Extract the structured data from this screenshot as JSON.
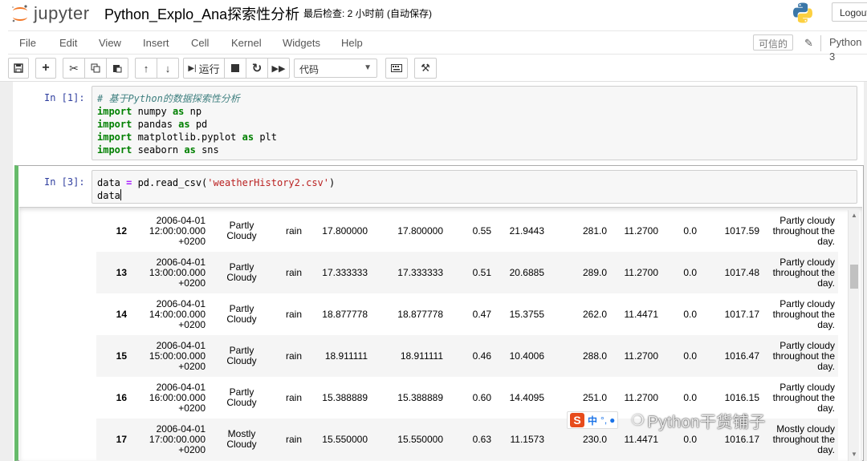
{
  "header": {
    "logo_text": "jupyter",
    "notebook_title": "Python_Explo_Ana探索性分析",
    "checkpoint": "最后检查: 2 小时前  (自动保存)",
    "logout_label": "Logout"
  },
  "menubar": {
    "items": [
      "File",
      "Edit",
      "View",
      "Insert",
      "Cell",
      "Kernel",
      "Widgets",
      "Help"
    ],
    "trusted_label": "可信的",
    "kernel_name": "Python 3"
  },
  "toolbar": {
    "run_label": "运行",
    "cell_type": "代码"
  },
  "cells": [
    {
      "prompt": "In  [1]:",
      "lines": [
        [
          {
            "t": "# 基于Python的数据探索性分析",
            "c": "c-comment"
          }
        ],
        [
          {
            "t": "import",
            "c": "c-kw"
          },
          {
            "t": " numpy ",
            "c": ""
          },
          {
            "t": "as",
            "c": "c-kw"
          },
          {
            "t": " np",
            "c": ""
          }
        ],
        [
          {
            "t": "import",
            "c": "c-kw"
          },
          {
            "t": " pandas ",
            "c": ""
          },
          {
            "t": "as",
            "c": "c-kw"
          },
          {
            "t": " pd",
            "c": ""
          }
        ],
        [
          {
            "t": "import",
            "c": "c-kw"
          },
          {
            "t": " matplotlib.pyplot ",
            "c": ""
          },
          {
            "t": "as",
            "c": "c-kw"
          },
          {
            "t": " plt",
            "c": ""
          }
        ],
        [
          {
            "t": "import",
            "c": "c-kw"
          },
          {
            "t": " seaborn ",
            "c": ""
          },
          {
            "t": "as",
            "c": "c-kw"
          },
          {
            "t": " sns",
            "c": ""
          }
        ]
      ]
    },
    {
      "prompt": "In  [3]:",
      "lines": [
        [
          {
            "t": "data ",
            "c": ""
          },
          {
            "t": "=",
            "c": "c-op"
          },
          {
            "t": " pd.read_csv(",
            "c": ""
          },
          {
            "t": "'weatherHistory2.csv'",
            "c": "c-str"
          },
          {
            "t": ")",
            "c": ""
          }
        ],
        [
          {
            "t": "data",
            "c": ""
          }
        ]
      ]
    }
  ],
  "table": {
    "rows": [
      {
        "index": "12",
        "date": [
          "2006-04-01",
          "12:00:00.000",
          "+0200"
        ],
        "summary": [
          "Partly",
          "Cloudy"
        ],
        "precip": "rain",
        "temp": "17.800000",
        "apparent": "17.800000",
        "humidity": "0.55",
        "wind_speed": "21.9443",
        "wind_bearing": "281.0",
        "visibility": "11.2700",
        "loud_cover": "0.0",
        "pressure": "1017.59",
        "daily": [
          "Partly cloudy",
          "throughout the",
          "day."
        ]
      },
      {
        "index": "13",
        "date": [
          "2006-04-01",
          "13:00:00.000",
          "+0200"
        ],
        "summary": [
          "Partly",
          "Cloudy"
        ],
        "precip": "rain",
        "temp": "17.333333",
        "apparent": "17.333333",
        "humidity": "0.51",
        "wind_speed": "20.6885",
        "wind_bearing": "289.0",
        "visibility": "11.2700",
        "loud_cover": "0.0",
        "pressure": "1017.48",
        "daily": [
          "Partly cloudy",
          "throughout the",
          "day."
        ]
      },
      {
        "index": "14",
        "date": [
          "2006-04-01",
          "14:00:00.000",
          "+0200"
        ],
        "summary": [
          "Partly",
          "Cloudy"
        ],
        "precip": "rain",
        "temp": "18.877778",
        "apparent": "18.877778",
        "humidity": "0.47",
        "wind_speed": "15.3755",
        "wind_bearing": "262.0",
        "visibility": "11.4471",
        "loud_cover": "0.0",
        "pressure": "1017.17",
        "daily": [
          "Partly cloudy",
          "throughout the",
          "day."
        ]
      },
      {
        "index": "15",
        "date": [
          "2006-04-01",
          "15:00:00.000",
          "+0200"
        ],
        "summary": [
          "Partly",
          "Cloudy"
        ],
        "precip": "rain",
        "temp": "18.911111",
        "apparent": "18.911111",
        "humidity": "0.46",
        "wind_speed": "10.4006",
        "wind_bearing": "288.0",
        "visibility": "11.2700",
        "loud_cover": "0.0",
        "pressure": "1016.47",
        "daily": [
          "Partly cloudy",
          "throughout the",
          "day."
        ]
      },
      {
        "index": "16",
        "date": [
          "2006-04-01",
          "16:00:00.000",
          "+0200"
        ],
        "summary": [
          "Partly",
          "Cloudy"
        ],
        "precip": "rain",
        "temp": "15.388889",
        "apparent": "15.388889",
        "humidity": "0.60",
        "wind_speed": "14.4095",
        "wind_bearing": "251.0",
        "visibility": "11.2700",
        "loud_cover": "0.0",
        "pressure": "1016.15",
        "daily": [
          "Partly cloudy",
          "throughout the",
          "day."
        ]
      },
      {
        "index": "17",
        "date": [
          "2006-04-01",
          "17:00:00.000",
          "+0200"
        ],
        "summary": [
          "Mostly",
          "Cloudy"
        ],
        "precip": "rain",
        "temp": "15.550000",
        "apparent": "15.550000",
        "humidity": "0.63",
        "wind_speed": "11.1573",
        "wind_bearing": "230.0",
        "visibility": "11.4471",
        "loud_cover": "0.0",
        "pressure": "1016.17",
        "daily": [
          "Mostly cloudy",
          "throughout the",
          "day."
        ]
      }
    ]
  },
  "watermark": {
    "ime_label": "中",
    "text": "Python干货铺子"
  },
  "colors": {
    "jupyter_orange": "#f37726",
    "selected_cell_border": "#66bb6a",
    "prompt_blue": "#303f9f"
  }
}
